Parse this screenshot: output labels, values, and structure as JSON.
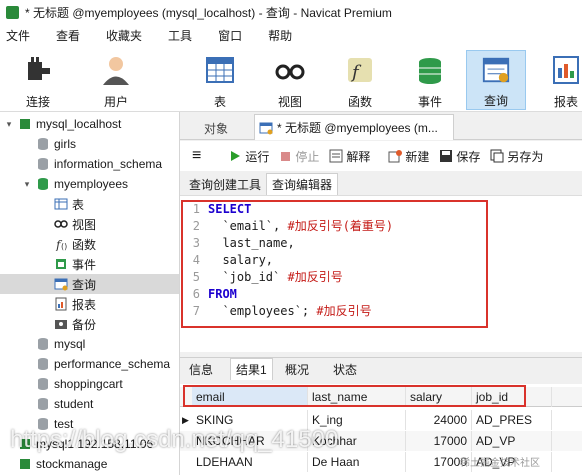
{
  "window": {
    "title": "* 无标题 @myemployees (mysql_localhost) - 查询 - Navicat Premium"
  },
  "menu": [
    "文件",
    "查看",
    "收藏夹",
    "工具",
    "窗口",
    "帮助"
  ],
  "toolbar": [
    {
      "label": "连接",
      "icon": "plug-icon"
    },
    {
      "label": "用户",
      "icon": "user-icon"
    },
    {
      "label": "表",
      "icon": "table-icon"
    },
    {
      "label": "视图",
      "icon": "glasses-icon"
    },
    {
      "label": "函数",
      "icon": "function-icon"
    },
    {
      "label": "事件",
      "icon": "event-icon"
    },
    {
      "label": "查询",
      "icon": "query-icon",
      "active": true
    },
    {
      "label": "报表",
      "icon": "report-icon"
    }
  ],
  "sidebar": [
    {
      "label": "mysql_localhost",
      "depth": 0,
      "expanded": true,
      "icon": "connection-icon"
    },
    {
      "label": "girls",
      "depth": 1,
      "icon": "database-icon"
    },
    {
      "label": "information_schema",
      "depth": 1,
      "icon": "database-icon"
    },
    {
      "label": "myemployees",
      "depth": 1,
      "expanded": true,
      "icon": "database-icon-active"
    },
    {
      "label": "表",
      "depth": 2,
      "icon": "table-icon"
    },
    {
      "label": "视图",
      "depth": 2,
      "icon": "glasses-icon"
    },
    {
      "label": "函数",
      "depth": 2,
      "icon": "function-icon"
    },
    {
      "label": "事件",
      "depth": 2,
      "icon": "event-icon"
    },
    {
      "label": "查询",
      "depth": 2,
      "icon": "query-icon",
      "selected": true
    },
    {
      "label": "报表",
      "depth": 2,
      "icon": "report-icon"
    },
    {
      "label": "备份",
      "depth": 2,
      "icon": "backup-icon"
    },
    {
      "label": "mysql",
      "depth": 1,
      "icon": "database-icon"
    },
    {
      "label": "performance_schema",
      "depth": 1,
      "icon": "database-icon"
    },
    {
      "label": "shoppingcart",
      "depth": 1,
      "icon": "database-icon"
    },
    {
      "label": "student",
      "depth": 1,
      "icon": "database-icon"
    },
    {
      "label": "test",
      "depth": 1,
      "icon": "database-icon"
    },
    {
      "label": "mysql1 192.158.11.06",
      "depth": 0,
      "icon": "connection-icon"
    },
    {
      "label": "stockmanage",
      "depth": 0,
      "icon": "connection-icon"
    }
  ],
  "tabs": {
    "objects": "对象",
    "query": "* 无标题 @myemployees (m..."
  },
  "query_toolbar": {
    "menu": "≡",
    "run": "运行",
    "stop": "停止",
    "explain": "解释",
    "new": "新建",
    "save": "保存",
    "save_as": "另存为"
  },
  "subtabs": [
    "查询创建工具",
    "查询编辑器"
  ],
  "code": [
    {
      "n": "1",
      "parts": [
        {
          "t": "SELECT",
          "c": "kw"
        }
      ]
    },
    {
      "n": "2",
      "parts": [
        {
          "t": "  `email`, ",
          "c": ""
        },
        {
          "t": "#加反引号(着重号)",
          "c": "cm"
        }
      ]
    },
    {
      "n": "3",
      "parts": [
        {
          "t": "  last_name,",
          "c": ""
        }
      ]
    },
    {
      "n": "4",
      "parts": [
        {
          "t": "  salary,",
          "c": ""
        }
      ]
    },
    {
      "n": "5",
      "parts": [
        {
          "t": "  `job_id` ",
          "c": ""
        },
        {
          "t": "#加反引号",
          "c": "cm"
        }
      ]
    },
    {
      "n": "6",
      "parts": [
        {
          "t": "FROM",
          "c": "kw"
        }
      ]
    },
    {
      "n": "7",
      "parts": [
        {
          "t": "  `employees`; ",
          "c": ""
        },
        {
          "t": "#加反引号",
          "c": "cm"
        }
      ]
    }
  ],
  "result_tabs": [
    "信息",
    "结果1",
    "概况",
    "状态"
  ],
  "grid": {
    "columns": [
      "email",
      "last_name",
      "salary",
      "job_id"
    ],
    "rows": [
      [
        "SKING",
        "K_ing",
        "24000",
        "AD_PRES"
      ],
      [
        "NKOCHHAR",
        "Kochhar",
        "17000",
        "AD_VP"
      ],
      [
        "LDEHAAN",
        "De Haan",
        "17000",
        "AD_VP"
      ]
    ]
  },
  "watermark": {
    "main": "https://blog.csdn.net/qq_41500",
    "secondary": "稀土掘金技术社区"
  }
}
